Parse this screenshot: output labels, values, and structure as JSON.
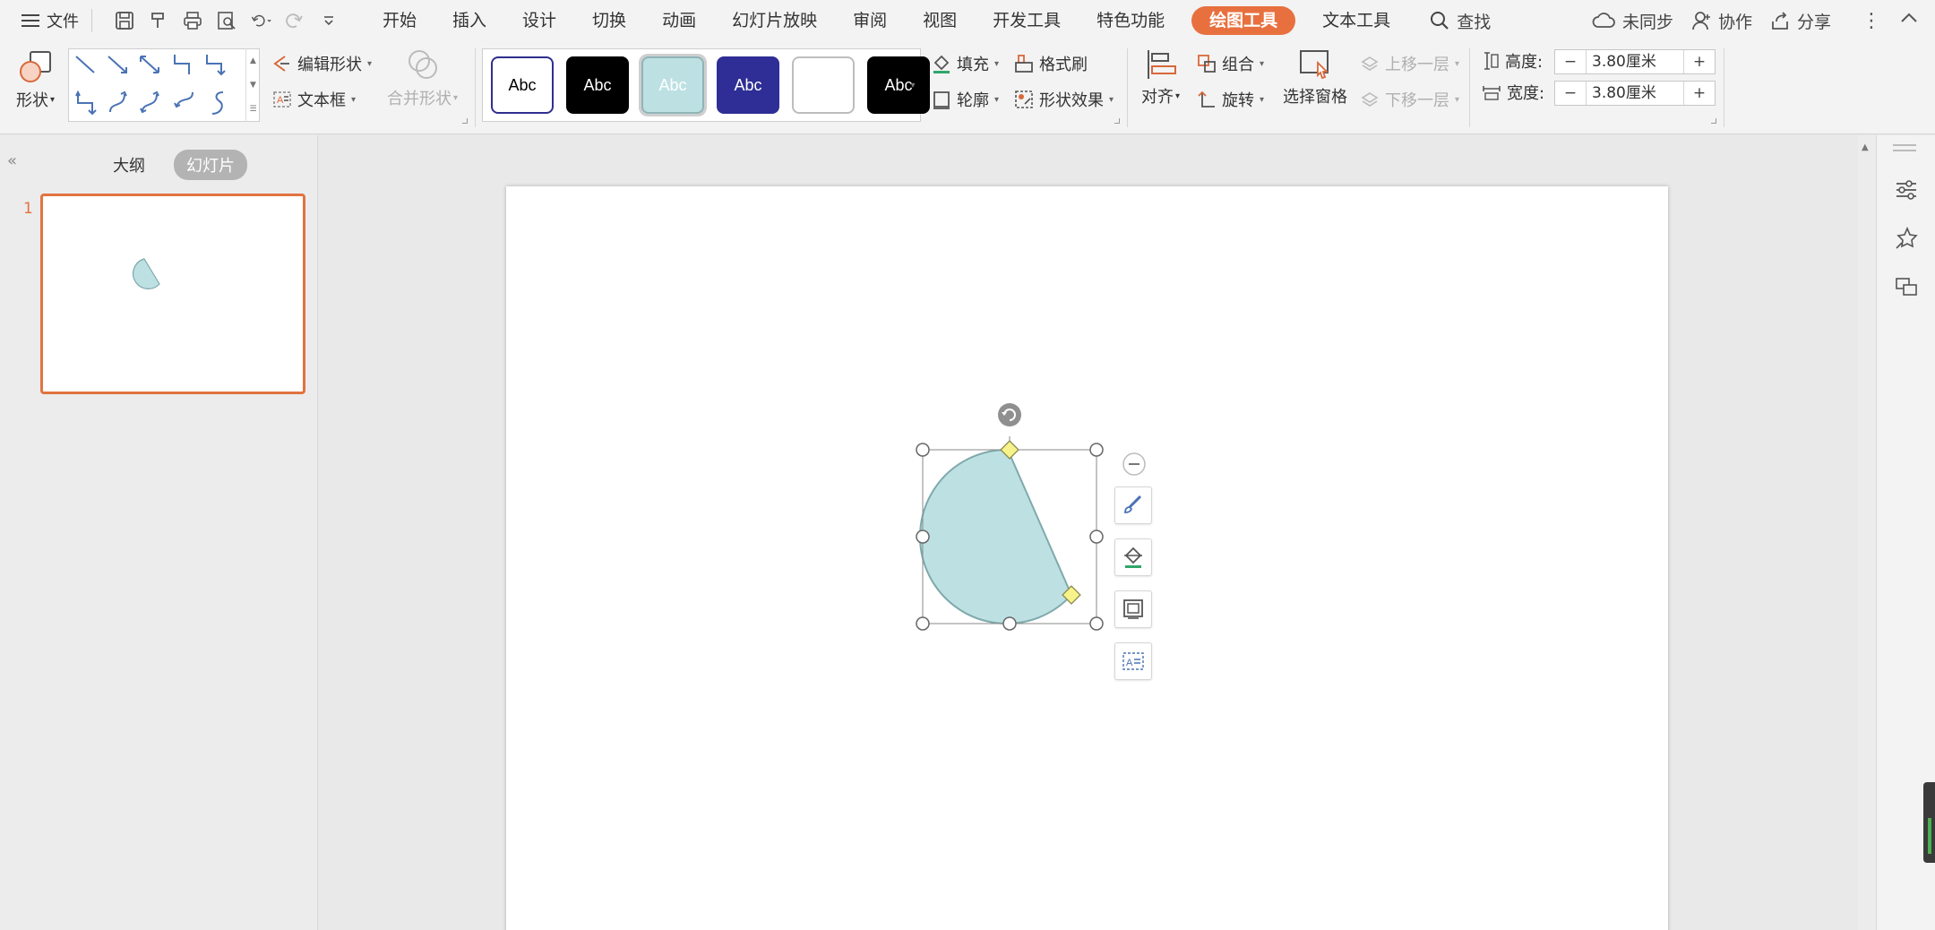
{
  "menu": {
    "file_label": "文件",
    "tabs": [
      "开始",
      "插入",
      "设计",
      "切换",
      "动画",
      "幻灯片放映",
      "审阅",
      "视图",
      "开发工具",
      "特色功能",
      "绘图工具",
      "文本工具"
    ],
    "search_label": "查找",
    "sync_label": "未同步",
    "collab_label": "协作",
    "share_label": "分享"
  },
  "ribbon": {
    "shape_label": "形状",
    "edit_shape_label": "编辑形状",
    "textbox_label": "文本框",
    "merge_shape_label": "合并形状",
    "style_boxes": [
      {
        "text": "Abc",
        "bg": "#ffffff",
        "fg": "#000000",
        "border": "#2f2f8f"
      },
      {
        "text": "Abc",
        "bg": "#000000",
        "fg": "#ffffff",
        "border": "#000000"
      },
      {
        "text": "Abc",
        "bg": "#bde1e3",
        "fg": "#ffffff",
        "border": "#8fb5b8"
      },
      {
        "text": "Abc",
        "bg": "#2e2e96",
        "fg": "#ffffff",
        "border": "#2e2e96"
      },
      {
        "text": "",
        "bg": "#ffffff",
        "fg": "#000000",
        "border": "#bdbdbd"
      },
      {
        "text": "Abc",
        "bg": "#000000",
        "fg": "#ffffff",
        "border": "#000000"
      }
    ],
    "fill_label": "填充",
    "format_brush_label": "格式刷",
    "outline_label": "轮廓",
    "shape_effect_label": "形状效果",
    "align_label": "对齐",
    "group_label": "组合",
    "rotate_label": "旋转",
    "selection_pane_label": "选择窗格",
    "bring_forward_label": "上移一层",
    "send_backward_label": "下移一层",
    "height_label": "高度:",
    "height_value": "3.80厘米",
    "width_label": "宽度:",
    "width_value": "3.80厘米",
    "minus": "−",
    "plus": "+"
  },
  "left_panel": {
    "outline_tab": "大纲",
    "slides_tab": "幻灯片",
    "slide_number": "1",
    "collapse_icon": "double-chevron-left-icon"
  },
  "colors": {
    "accent": "#e8703f",
    "shape_fill": "#bde1e3",
    "shape_stroke": "#7fa9ac",
    "handle_yellow": "#f7f38a"
  }
}
